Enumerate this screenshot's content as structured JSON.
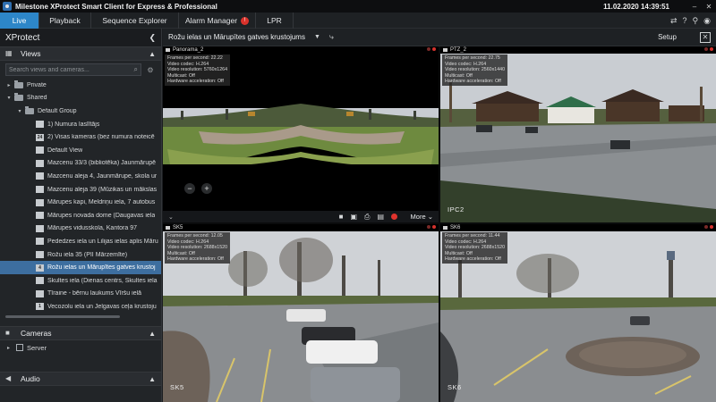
{
  "window": {
    "title": "Milestone XProtect Smart Client for Express & Professional",
    "datetime": "11.02.2020 14:39:51"
  },
  "tabs": [
    {
      "label": "Live",
      "active": true
    },
    {
      "label": "Playback",
      "active": false
    },
    {
      "label": "Sequence Explorer",
      "active": false
    },
    {
      "label": "Alarm Manager",
      "active": false,
      "badge": "!"
    },
    {
      "label": "LPR",
      "active": false
    }
  ],
  "left_panel": {
    "title": "XProtect",
    "views_header": "Views",
    "search_placeholder": "Search views and cameras...",
    "tree": [
      {
        "label": "Private",
        "level": 0,
        "kind": "folder",
        "expander": "▸"
      },
      {
        "label": "Shared",
        "level": 0,
        "kind": "folder",
        "expander": "▾"
      },
      {
        "label": "Default Group",
        "level": 1,
        "kind": "folder",
        "expander": "▾"
      },
      {
        "label": "1) Numura laslītājs",
        "level": 2,
        "kind": "view"
      },
      {
        "label": "2) Visas kameras (bez numura noteicē",
        "level": 2,
        "kind": "view"
      },
      {
        "label": "Default View",
        "level": 2,
        "kind": "view"
      },
      {
        "label": "Mazcenu 33/3 (bibliotēka) Jaunmārupē",
        "level": 2,
        "kind": "view"
      },
      {
        "label": "Mazcenu aleja 4, Jaunmārupe, skola ur",
        "level": 2,
        "kind": "view"
      },
      {
        "label": "Mazcenu aleja 39 (Mūzikas un mākslas",
        "level": 2,
        "kind": "view"
      },
      {
        "label": "Mārupes kapi, Meldriņu iela, 7 autobus",
        "level": 2,
        "kind": "view"
      },
      {
        "label": "Mārupes novada dome (Daugavas iela",
        "level": 2,
        "kind": "view"
      },
      {
        "label": "Mārupes vidusskola, Kantora 97",
        "level": 2,
        "kind": "view"
      },
      {
        "label": "Pededzes iela un Lilijas ielas aplis Māru",
        "level": 2,
        "kind": "view"
      },
      {
        "label": "Rožu iela 35 (PII Mārzemīte)",
        "level": 2,
        "kind": "view"
      },
      {
        "label": "Rožu ielas un Mārupītes gatves krustoj",
        "level": 2,
        "kind": "view",
        "selected": true
      },
      {
        "label": "Skultes iela (Dienas centrs, Skultes iela",
        "level": 2,
        "kind": "view"
      },
      {
        "label": "Tīraine - bērnu laukums Vīršu ielā",
        "level": 2,
        "kind": "view"
      },
      {
        "label": "Vecozolu iela un Jelgavas ceļa krustoju",
        "level": 2,
        "kind": "view"
      }
    ],
    "cameras_header": "Cameras",
    "server_label": "Server",
    "audio_header": "Audio"
  },
  "view_toolbar": {
    "view_name": "Rožu ielas un Mārupītes gatves krustojums",
    "setup_label": "Setup"
  },
  "cameras": [
    {
      "name": "Panorama_2",
      "fps": "Frames per second: 22.22",
      "codec": "Video codec: H.264",
      "resolution": "Video resolution: 5760x1264",
      "multicast": "Multicast: Off",
      "hw": "Hardware acceleration: Off",
      "overlay_label": "",
      "more_label": "More"
    },
    {
      "name": "PTZ_2",
      "fps": "Frames per second: 22.75",
      "codec": "Video codec: H.264",
      "resolution": "Video resolution: 2560x1440",
      "multicast": "Multicast: Off",
      "hw": "Hardware acceleration: Off",
      "overlay_label": "IPC2"
    },
    {
      "name": "SK5",
      "fps": "Frames per second: 12.05",
      "codec": "Video codec: H.264",
      "resolution": "Video resolution: 2688x1520",
      "multicast": "Multicast: Off",
      "hw": "Hardware acceleration: Off",
      "overlay_label": "SK5"
    },
    {
      "name": "SK6",
      "fps": "Frames per second: 11.44",
      "codec": "Video codec: H.264",
      "resolution": "Video resolution: 2688x1520",
      "multicast": "Multicast: Off",
      "hw": "Hardware acceleration: Off",
      "overlay_label": "SK6"
    }
  ],
  "colors": {
    "accent": "#2d86c8",
    "alarm_badge": "#d9322b",
    "selection": "#3d6e9f",
    "recording": "#e0332d"
  }
}
